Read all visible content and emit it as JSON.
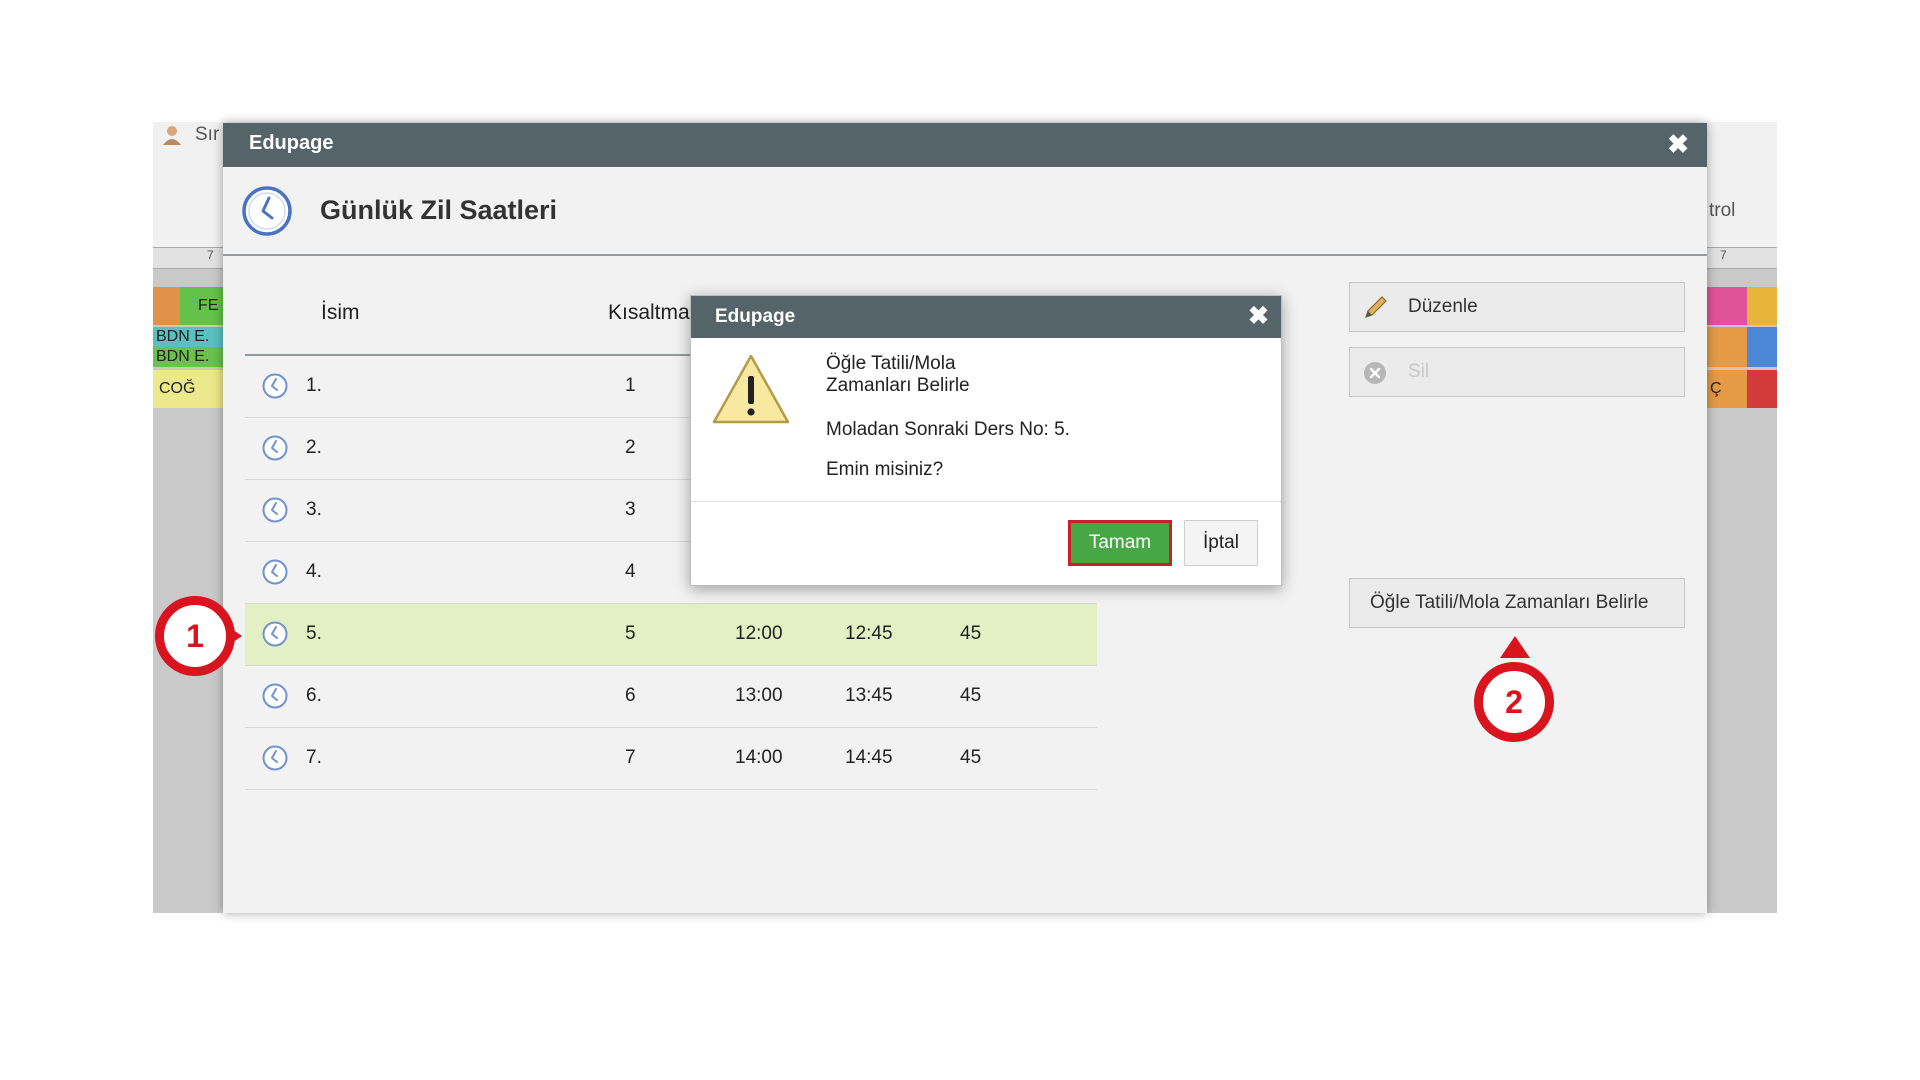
{
  "background_app": {
    "user_label": "Sır",
    "right_label": "trol",
    "ruler_number": "7",
    "cells": [
      "FE",
      "BDN E.",
      "BDN E.",
      "COĞ",
      "Ç"
    ]
  },
  "main_dialog": {
    "title": "Edupage",
    "close_glyph": "✖",
    "header_title": "Günlük Zil Saatleri",
    "table": {
      "columns": [
        "İsim",
        "Kısaltma"
      ],
      "rows": [
        {
          "name": "1.",
          "short": "1",
          "start": "",
          "end": "",
          "duration": ""
        },
        {
          "name": "2.",
          "short": "2",
          "start": "",
          "end": "",
          "duration": ""
        },
        {
          "name": "3.",
          "short": "3",
          "start": "",
          "end": "",
          "duration": ""
        },
        {
          "name": "4.",
          "short": "4",
          "start": "",
          "end": "",
          "duration": ""
        },
        {
          "name": "5.",
          "short": "5",
          "start": "12:00",
          "end": "12:45",
          "duration": "45",
          "selected": true
        },
        {
          "name": "6.",
          "short": "6",
          "start": "13:00",
          "end": "13:45",
          "duration": "45"
        },
        {
          "name": "7.",
          "short": "7",
          "start": "14:00",
          "end": "14:45",
          "duration": "45"
        }
      ]
    },
    "buttons": {
      "edit": "Düzenle",
      "delete": "Sil",
      "lunch": "Öğle Tatili/Mola Zamanları Belirle"
    }
  },
  "confirm_dialog": {
    "title": "Edupage",
    "close_glyph": "✖",
    "message_line1": "Öğle Tatili/Mola",
    "message_line2": "Zamanları Belirle",
    "next_lesson": "Moladan Sonraki Ders No: 5.",
    "question": "Emin misiniz?",
    "ok": "Tamam",
    "cancel": "İptal"
  },
  "markers": [
    "1",
    "2"
  ],
  "colors": {
    "titlebar": "#546469",
    "ok_green": "#47a747",
    "marker_red": "#d9141e",
    "selected_row": "#e2f0c3"
  }
}
